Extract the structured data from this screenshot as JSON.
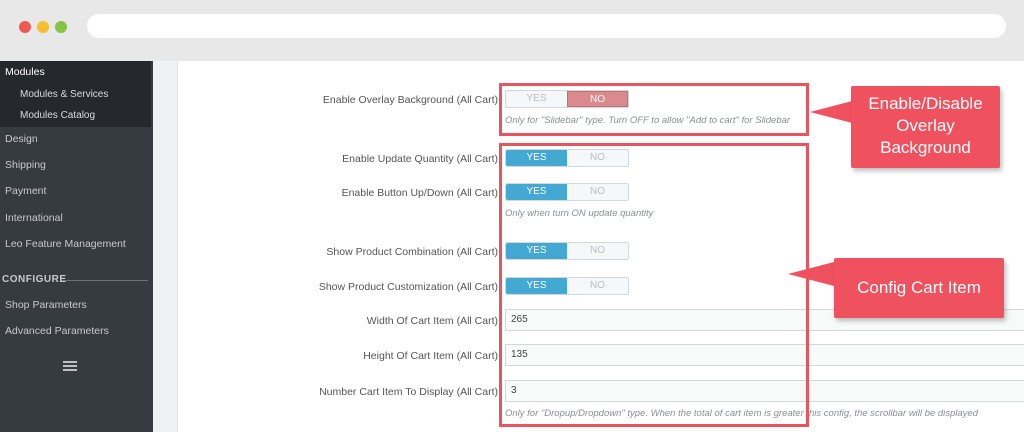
{
  "sidebar": {
    "active_section": "Modules",
    "sub_items": [
      "Modules & Services",
      "Modules Catalog"
    ],
    "items": [
      "Design",
      "Shipping",
      "Payment",
      "International",
      "Leo Feature Management"
    ],
    "configure_label": "CONFIGURE",
    "configure_items": [
      "Shop Parameters",
      "Advanced Parameters"
    ]
  },
  "form": {
    "overlay": {
      "label": "Enable Overlay Background (All Cart)",
      "yes": "YES",
      "no": "NO",
      "hint": "Only for \"Slidebar\" type. Turn OFF to allow \"Add to cart\" for Slidebar"
    },
    "update_qty": {
      "label": "Enable Update Quantity (All Cart)",
      "yes": "YES",
      "no": "NO"
    },
    "button_updown": {
      "label": "Enable Button Up/Down (All Cart)",
      "yes": "YES",
      "no": "NO",
      "hint": "Only when turn ON update quantity"
    },
    "combination": {
      "label": "Show Product Combination (All Cart)",
      "yes": "YES",
      "no": "NO"
    },
    "customization": {
      "label": "Show Product Customization (All Cart)",
      "yes": "YES",
      "no": "NO"
    },
    "width": {
      "label": "Width Of Cart Item (All Cart)",
      "value": "265"
    },
    "height": {
      "label": "Height Of Cart Item (All Cart)",
      "value": "135"
    },
    "number": {
      "label": "Number Cart Item To Display (All Cart)",
      "value": "3",
      "hint": "Only for \"Dropup/Dropdown\" type. When the total of cart item is greater this config, the scrollbar will be displayed"
    }
  },
  "callouts": {
    "overlay": [
      "Enable/Disable",
      "Overlay",
      "Background"
    ],
    "cart_item": "Config Cart Item"
  },
  "colors": {
    "accent_blue": "#43a8d2",
    "callout_red": "#f0515e",
    "sidebar_bg": "#363a41"
  }
}
